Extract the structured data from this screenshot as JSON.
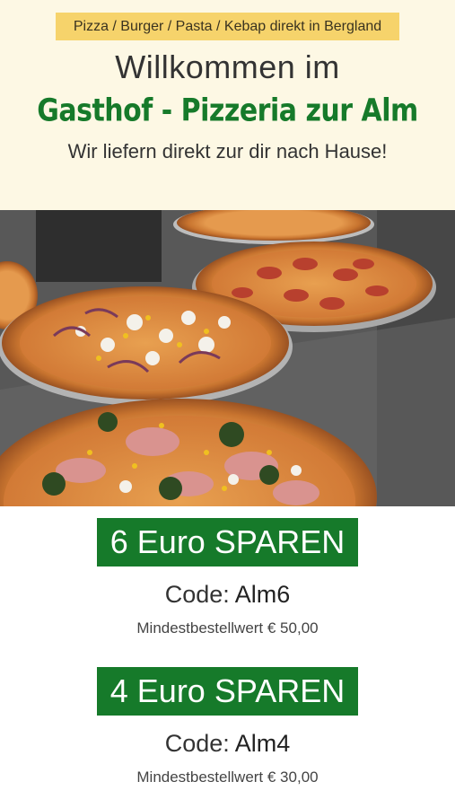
{
  "header": {
    "tagline": "Pizza / Burger / Pasta / Kebap direkt in Bergland",
    "welcome": "Willkommen im",
    "brand": "Gasthof - Pizzeria zur Alm",
    "delivery": "Wir liefern direkt zur dir nach Hause!"
  },
  "photo": {
    "subject": "pizzas-on-counter-photo"
  },
  "offers": [
    {
      "amount": "6 Euro",
      "save": "SPAREN",
      "code_label": "Code:",
      "code": "Alm6",
      "minimum": "Mindestbestellwert € 50,00"
    },
    {
      "amount": "4 Euro",
      "save": "SPAREN",
      "code_label": "Code:",
      "code": "Alm4",
      "minimum": "Mindestbestellwert € 30,00"
    }
  ],
  "colors": {
    "header_bg": "#fdf8e4",
    "tagline_bg": "#f6d36b",
    "brand_green": "#167a2a"
  }
}
